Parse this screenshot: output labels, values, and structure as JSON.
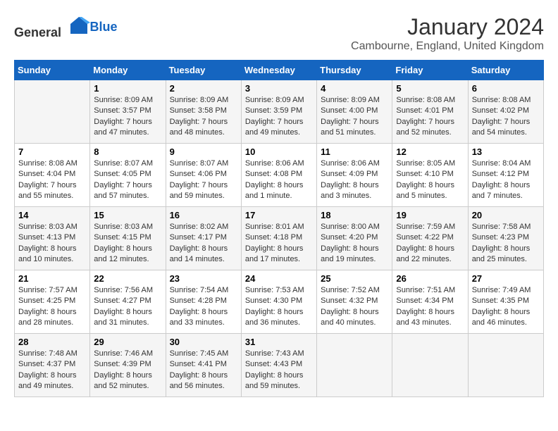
{
  "header": {
    "logo_general": "General",
    "logo_blue": "Blue",
    "title": "January 2024",
    "subtitle": "Cambourne, England, United Kingdom"
  },
  "days_of_week": [
    "Sunday",
    "Monday",
    "Tuesday",
    "Wednesday",
    "Thursday",
    "Friday",
    "Saturday"
  ],
  "weeks": [
    [
      {
        "day": "",
        "sunrise": "",
        "sunset": "",
        "daylight": ""
      },
      {
        "day": "1",
        "sunrise": "Sunrise: 8:09 AM",
        "sunset": "Sunset: 3:57 PM",
        "daylight": "Daylight: 7 hours and 47 minutes."
      },
      {
        "day": "2",
        "sunrise": "Sunrise: 8:09 AM",
        "sunset": "Sunset: 3:58 PM",
        "daylight": "Daylight: 7 hours and 48 minutes."
      },
      {
        "day": "3",
        "sunrise": "Sunrise: 8:09 AM",
        "sunset": "Sunset: 3:59 PM",
        "daylight": "Daylight: 7 hours and 49 minutes."
      },
      {
        "day": "4",
        "sunrise": "Sunrise: 8:09 AM",
        "sunset": "Sunset: 4:00 PM",
        "daylight": "Daylight: 7 hours and 51 minutes."
      },
      {
        "day": "5",
        "sunrise": "Sunrise: 8:08 AM",
        "sunset": "Sunset: 4:01 PM",
        "daylight": "Daylight: 7 hours and 52 minutes."
      },
      {
        "day": "6",
        "sunrise": "Sunrise: 8:08 AM",
        "sunset": "Sunset: 4:02 PM",
        "daylight": "Daylight: 7 hours and 54 minutes."
      }
    ],
    [
      {
        "day": "7",
        "sunrise": "Sunrise: 8:08 AM",
        "sunset": "Sunset: 4:04 PM",
        "daylight": "Daylight: 7 hours and 55 minutes."
      },
      {
        "day": "8",
        "sunrise": "Sunrise: 8:07 AM",
        "sunset": "Sunset: 4:05 PM",
        "daylight": "Daylight: 7 hours and 57 minutes."
      },
      {
        "day": "9",
        "sunrise": "Sunrise: 8:07 AM",
        "sunset": "Sunset: 4:06 PM",
        "daylight": "Daylight: 7 hours and 59 minutes."
      },
      {
        "day": "10",
        "sunrise": "Sunrise: 8:06 AM",
        "sunset": "Sunset: 4:08 PM",
        "daylight": "Daylight: 8 hours and 1 minute."
      },
      {
        "day": "11",
        "sunrise": "Sunrise: 8:06 AM",
        "sunset": "Sunset: 4:09 PM",
        "daylight": "Daylight: 8 hours and 3 minutes."
      },
      {
        "day": "12",
        "sunrise": "Sunrise: 8:05 AM",
        "sunset": "Sunset: 4:10 PM",
        "daylight": "Daylight: 8 hours and 5 minutes."
      },
      {
        "day": "13",
        "sunrise": "Sunrise: 8:04 AM",
        "sunset": "Sunset: 4:12 PM",
        "daylight": "Daylight: 8 hours and 7 minutes."
      }
    ],
    [
      {
        "day": "14",
        "sunrise": "Sunrise: 8:03 AM",
        "sunset": "Sunset: 4:13 PM",
        "daylight": "Daylight: 8 hours and 10 minutes."
      },
      {
        "day": "15",
        "sunrise": "Sunrise: 8:03 AM",
        "sunset": "Sunset: 4:15 PM",
        "daylight": "Daylight: 8 hours and 12 minutes."
      },
      {
        "day": "16",
        "sunrise": "Sunrise: 8:02 AM",
        "sunset": "Sunset: 4:17 PM",
        "daylight": "Daylight: 8 hours and 14 minutes."
      },
      {
        "day": "17",
        "sunrise": "Sunrise: 8:01 AM",
        "sunset": "Sunset: 4:18 PM",
        "daylight": "Daylight: 8 hours and 17 minutes."
      },
      {
        "day": "18",
        "sunrise": "Sunrise: 8:00 AM",
        "sunset": "Sunset: 4:20 PM",
        "daylight": "Daylight: 8 hours and 19 minutes."
      },
      {
        "day": "19",
        "sunrise": "Sunrise: 7:59 AM",
        "sunset": "Sunset: 4:22 PM",
        "daylight": "Daylight: 8 hours and 22 minutes."
      },
      {
        "day": "20",
        "sunrise": "Sunrise: 7:58 AM",
        "sunset": "Sunset: 4:23 PM",
        "daylight": "Daylight: 8 hours and 25 minutes."
      }
    ],
    [
      {
        "day": "21",
        "sunrise": "Sunrise: 7:57 AM",
        "sunset": "Sunset: 4:25 PM",
        "daylight": "Daylight: 8 hours and 28 minutes."
      },
      {
        "day": "22",
        "sunrise": "Sunrise: 7:56 AM",
        "sunset": "Sunset: 4:27 PM",
        "daylight": "Daylight: 8 hours and 31 minutes."
      },
      {
        "day": "23",
        "sunrise": "Sunrise: 7:54 AM",
        "sunset": "Sunset: 4:28 PM",
        "daylight": "Daylight: 8 hours and 33 minutes."
      },
      {
        "day": "24",
        "sunrise": "Sunrise: 7:53 AM",
        "sunset": "Sunset: 4:30 PM",
        "daylight": "Daylight: 8 hours and 36 minutes."
      },
      {
        "day": "25",
        "sunrise": "Sunrise: 7:52 AM",
        "sunset": "Sunset: 4:32 PM",
        "daylight": "Daylight: 8 hours and 40 minutes."
      },
      {
        "day": "26",
        "sunrise": "Sunrise: 7:51 AM",
        "sunset": "Sunset: 4:34 PM",
        "daylight": "Daylight: 8 hours and 43 minutes."
      },
      {
        "day": "27",
        "sunrise": "Sunrise: 7:49 AM",
        "sunset": "Sunset: 4:35 PM",
        "daylight": "Daylight: 8 hours and 46 minutes."
      }
    ],
    [
      {
        "day": "28",
        "sunrise": "Sunrise: 7:48 AM",
        "sunset": "Sunset: 4:37 PM",
        "daylight": "Daylight: 8 hours and 49 minutes."
      },
      {
        "day": "29",
        "sunrise": "Sunrise: 7:46 AM",
        "sunset": "Sunset: 4:39 PM",
        "daylight": "Daylight: 8 hours and 52 minutes."
      },
      {
        "day": "30",
        "sunrise": "Sunrise: 7:45 AM",
        "sunset": "Sunset: 4:41 PM",
        "daylight": "Daylight: 8 hours and 56 minutes."
      },
      {
        "day": "31",
        "sunrise": "Sunrise: 7:43 AM",
        "sunset": "Sunset: 4:43 PM",
        "daylight": "Daylight: 8 hours and 59 minutes."
      },
      {
        "day": "",
        "sunrise": "",
        "sunset": "",
        "daylight": ""
      },
      {
        "day": "",
        "sunrise": "",
        "sunset": "",
        "daylight": ""
      },
      {
        "day": "",
        "sunrise": "",
        "sunset": "",
        "daylight": ""
      }
    ]
  ]
}
